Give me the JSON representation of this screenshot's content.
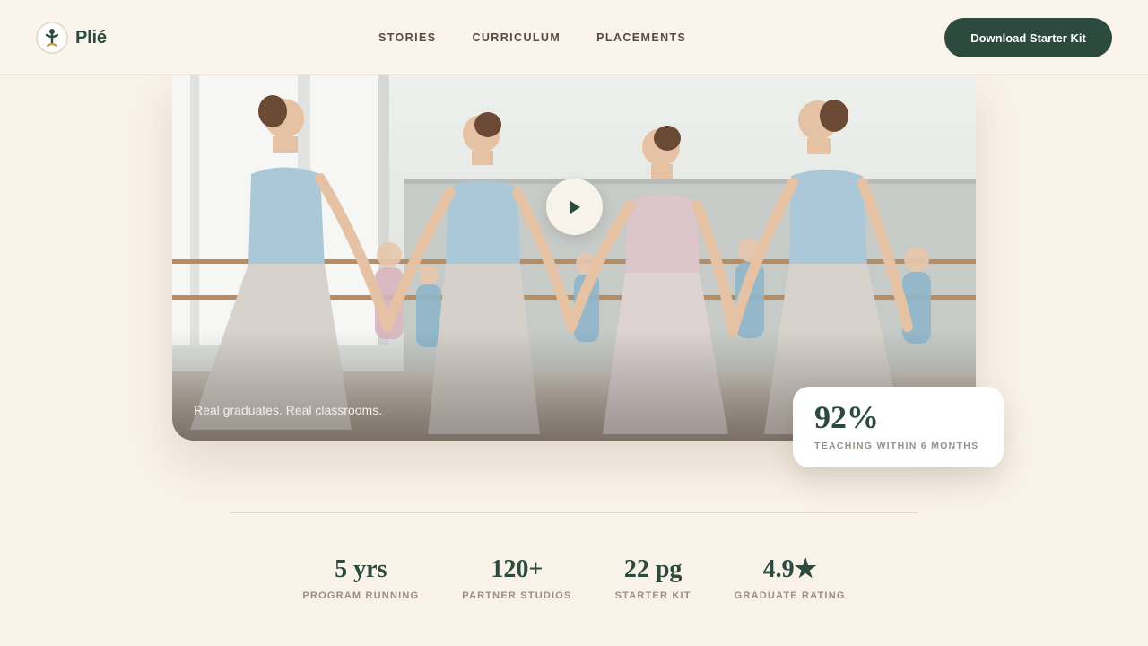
{
  "brand": {
    "name": "Plié"
  },
  "nav": {
    "items": [
      "STORIES",
      "CURRICULUM",
      "PLACEMENTS"
    ]
  },
  "cta": {
    "label": "Download Starter Kit"
  },
  "hero": {
    "caption": "Real graduates. Real classrooms."
  },
  "highlight": {
    "value": "92%",
    "label": "TEACHING WITHIN 6 MONTHS"
  },
  "stats": [
    {
      "value": "5 yrs",
      "label": "PROGRAM RUNNING"
    },
    {
      "value": "120+",
      "label": "PARTNER STUDIOS"
    },
    {
      "value": "22 pg",
      "label": "STARTER KIT"
    },
    {
      "value": "4.9★",
      "label": "GRADUATE RATING"
    }
  ],
  "colors": {
    "primary": "#2c4a3e",
    "background": "#f9f2e9",
    "muted": "#9a8f84"
  },
  "icons": {
    "logo": "dancer-logo-icon",
    "play": "play-icon"
  }
}
